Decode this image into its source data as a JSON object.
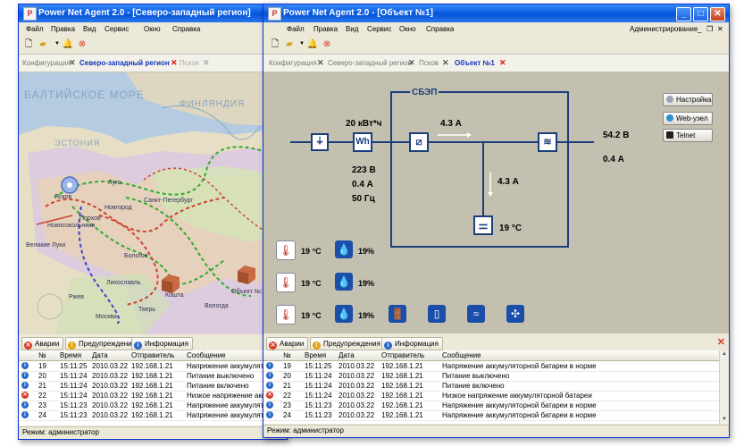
{
  "colors": {
    "accent": "#0a5ee5",
    "symbol": "#1a3f7c",
    "panel": "#c4c0b0",
    "alarm": "#d83a26",
    "warn": "#e6a40d",
    "info": "#2a68c9"
  },
  "left": {
    "title": "Power Net Agent 2.0 - [Северо-западный регион]",
    "menu": [
      "Файл",
      "Правка",
      "Вид",
      "Сервис",
      "Окно",
      "Справка"
    ],
    "tabs": [
      {
        "label": "Конфигурация",
        "active": false
      },
      {
        "label": "Северо-западный регион",
        "active": true
      },
      {
        "label": "Псков",
        "active": false
      }
    ],
    "map": {
      "sea": "БАЛТИЙСКОЕ МОРЕ",
      "labels": [
        "ФИНЛЯНДИЯ",
        "ЭСТОНИЯ",
        "Луга",
        "Псков",
        "Санкт-Петербург",
        "Новгород",
        "Порхов",
        "Новосокольники",
        "Великие Луки",
        "Лихославль",
        "Бологое",
        "Кошта",
        "Вологда",
        "Объект №1",
        "Ржев",
        "Москва",
        "Тверь"
      ]
    },
    "alarm_tabs": [
      "Аварии",
      "Предупреждения",
      "Информация"
    ],
    "columns": [
      "№",
      "Время",
      "Дата",
      "Отправитель",
      "Сообщение"
    ],
    "rows": [
      {
        "type": "info",
        "num": "19",
        "time": "15:11:25",
        "date": "2010.03.22",
        "sender": "192.168.1.21",
        "msg": "Напряжение аккумуляторной батареи в норме"
      },
      {
        "type": "info",
        "num": "20",
        "time": "15:11:24",
        "date": "2010.03.22",
        "sender": "192.168.1.21",
        "msg": "Питание выключено"
      },
      {
        "type": "info",
        "num": "21",
        "time": "15:11:24",
        "date": "2010.03.22",
        "sender": "192.168.1.21",
        "msg": "Питание включено"
      },
      {
        "type": "alarm",
        "num": "22",
        "time": "15:11:24",
        "date": "2010.03.22",
        "sender": "192.168.1.21",
        "msg": "Низкое напряжение аккумуляторной батареи"
      },
      {
        "type": "info",
        "num": "23",
        "time": "15:11:23",
        "date": "2010.03.22",
        "sender": "192.168.1.21",
        "msg": "Напряжение аккумуляторной батареи в норме"
      },
      {
        "type": "info",
        "num": "24",
        "time": "15:11:23",
        "date": "2010.03.22",
        "sender": "192.168.1.21",
        "msg": "Напряжение аккумуляторной батареи в норме"
      }
    ],
    "status": "Режим: администратор"
  },
  "right": {
    "title": "Power Net Agent 2.0 - [Объект №1]",
    "menu": [
      "Файл",
      "Правка",
      "Вид",
      "Сервис",
      "Окно",
      "Справка"
    ],
    "mode_menu": "Администрирование",
    "tabs": [
      {
        "label": "Конфигурация",
        "active": false
      },
      {
        "label": "Северо-западный регион",
        "active": false
      },
      {
        "label": "Псков",
        "active": false
      },
      {
        "label": "Объект №1",
        "active": true
      }
    ],
    "diagram": {
      "group": "СБЭП",
      "energy": "20 кВт*ч",
      "meter": "Wh",
      "in_voltage": "223 В",
      "in_current": "0.4 А",
      "in_freq": "50 Гц",
      "rect_current": "4.3 А",
      "batt_current": "4.3 А",
      "batt_temp": "19 °C",
      "out_voltage": "54.2 В",
      "out_current": "0.4 А"
    },
    "sensors": [
      {
        "temp": "19 °C",
        "hum": "19%"
      },
      {
        "temp": "19 °C",
        "hum": "19%"
      },
      {
        "temp": "19 °C",
        "hum": "19%"
      }
    ],
    "side_buttons": [
      "Настройка",
      "Web-узел",
      "Telnet"
    ],
    "alarm_tabs": [
      "Аварии",
      "Предупреждения",
      "Информация"
    ],
    "columns": [
      "№",
      "Время",
      "Дата",
      "Отправитель",
      "Сообщение"
    ],
    "rows": [
      {
        "type": "info",
        "num": "19",
        "time": "15:11:25",
        "date": "2010.03.22",
        "sender": "192.168.1.21",
        "msg": "Напряжение аккумуляторной батареи в норме"
      },
      {
        "type": "info",
        "num": "20",
        "time": "15:11:24",
        "date": "2010.03.22",
        "sender": "192.168.1.21",
        "msg": "Питание выключено"
      },
      {
        "type": "info",
        "num": "21",
        "time": "15:11:24",
        "date": "2010.03.22",
        "sender": "192.168.1.21",
        "msg": "Питание включено"
      },
      {
        "type": "alarm",
        "num": "22",
        "time": "15:11:24",
        "date": "2010.03.22",
        "sender": "192.168.1.21",
        "msg": "Низкое напряжение аккумуляторной батареи"
      },
      {
        "type": "info",
        "num": "23",
        "time": "15:11:23",
        "date": "2010.03.22",
        "sender": "192.168.1.21",
        "msg": "Напряжение аккумуляторной батареи в норме"
      },
      {
        "type": "info",
        "num": "24",
        "time": "15:11:23",
        "date": "2010.03.22",
        "sender": "192.168.1.21",
        "msg": "Напряжение аккумуляторной батареи в норме"
      }
    ],
    "status": "Режим: администратор"
  }
}
